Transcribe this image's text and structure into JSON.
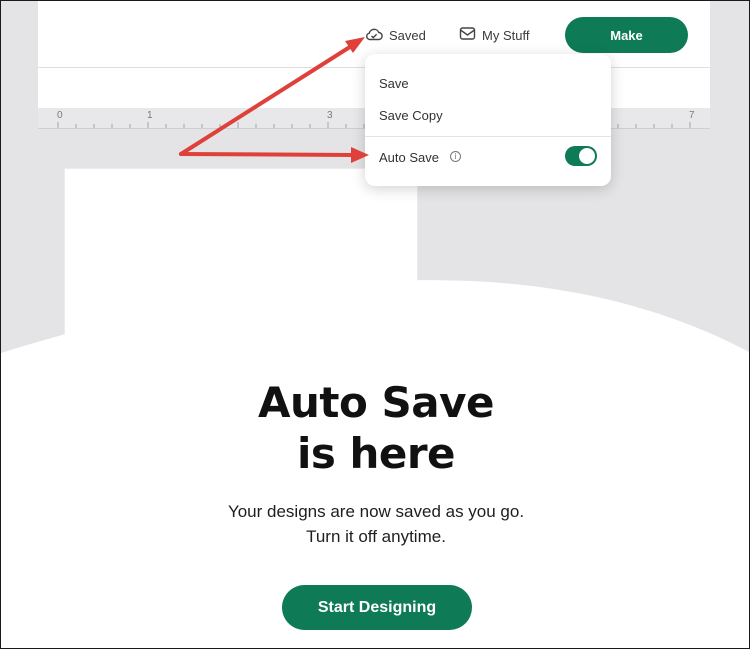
{
  "toolbar": {
    "saved_label": "Saved",
    "saved_icon": "cloud-check-icon",
    "mystuff_label": "My Stuff",
    "mystuff_icon": "inbox-icon",
    "make_label": "Make"
  },
  "ruler": {
    "labels": [
      "0",
      "1",
      "3",
      "7"
    ]
  },
  "dropdown": {
    "items": [
      {
        "label": "Save"
      },
      {
        "label": "Save Copy"
      }
    ],
    "auto_save": {
      "label": "Auto Save",
      "info_icon": "info-icon",
      "enabled": true
    }
  },
  "hero": {
    "title_line1": "Auto Save",
    "title_line2": "is here",
    "subtitle_line1": "Your designs are now saved as you go.",
    "subtitle_line2": "Turn it off anytime.",
    "cta_label": "Start Designing"
  },
  "colors": {
    "brand_green": "#0e7b56",
    "arrow_red": "#e0403a",
    "canvas_gray": "#e4e4e6"
  }
}
